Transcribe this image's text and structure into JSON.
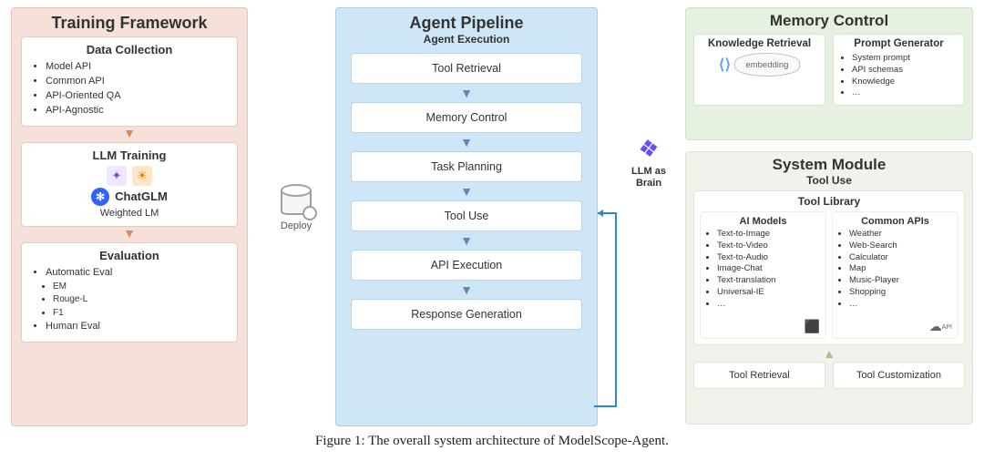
{
  "training_framework": {
    "title": "Training Framework",
    "data_collection": {
      "title": "Data Collection",
      "items": [
        "Model API",
        "Common API",
        "API-Oriented QA",
        "API-Agnostic"
      ]
    },
    "llm_training": {
      "title": "LLM Training",
      "chatglm": "ChatGLM",
      "weighted": "Weighted LM"
    },
    "evaluation": {
      "title": "Evaluation",
      "items": [
        "Automatic Eval"
      ],
      "sub_items": [
        "EM",
        "Rouge-L",
        "F1"
      ],
      "items2": [
        "Human Eval"
      ]
    }
  },
  "deploy_label": "Deploy",
  "agent_pipeline": {
    "title": "Agent Pipeline",
    "subtitle": "Agent Execution",
    "steps": [
      "Tool Retrieval",
      "Memory Control",
      "Task Planning",
      "Tool Use",
      "API Execution",
      "Response Generation"
    ]
  },
  "brain_label_1": "LLM as",
  "brain_label_2": "Brain",
  "memory_control": {
    "title": "Memory Control",
    "knowledge_retrieval": {
      "title": "Knowledge Retrieval",
      "embedding": "embedding"
    },
    "prompt_generator": {
      "title": "Prompt Generator",
      "items": [
        "System prompt",
        "API schemas",
        "Knowledge",
        "…"
      ]
    }
  },
  "system_module": {
    "title": "System Module",
    "subtitle": "Tool Use",
    "tool_library": {
      "title": "Tool Library",
      "ai_models": {
        "title": "AI Models",
        "items": [
          "Text-to-Image",
          "Text-to-Video",
          "Text-to-Audio",
          "Image-Chat",
          "Text-translation",
          "Universal-IE",
          "…"
        ]
      },
      "common_apis": {
        "title": "Common APIs",
        "items": [
          "Weather",
          "Web-Search",
          "Calculator",
          "Map",
          "Music-Player",
          "Shopping",
          "…"
        ],
        "api_tag": "API"
      }
    },
    "bottom": [
      "Tool Retrieval",
      "Tool Customization"
    ]
  },
  "caption": "Figure 1: The overall system architecture of ModelScope-Agent."
}
